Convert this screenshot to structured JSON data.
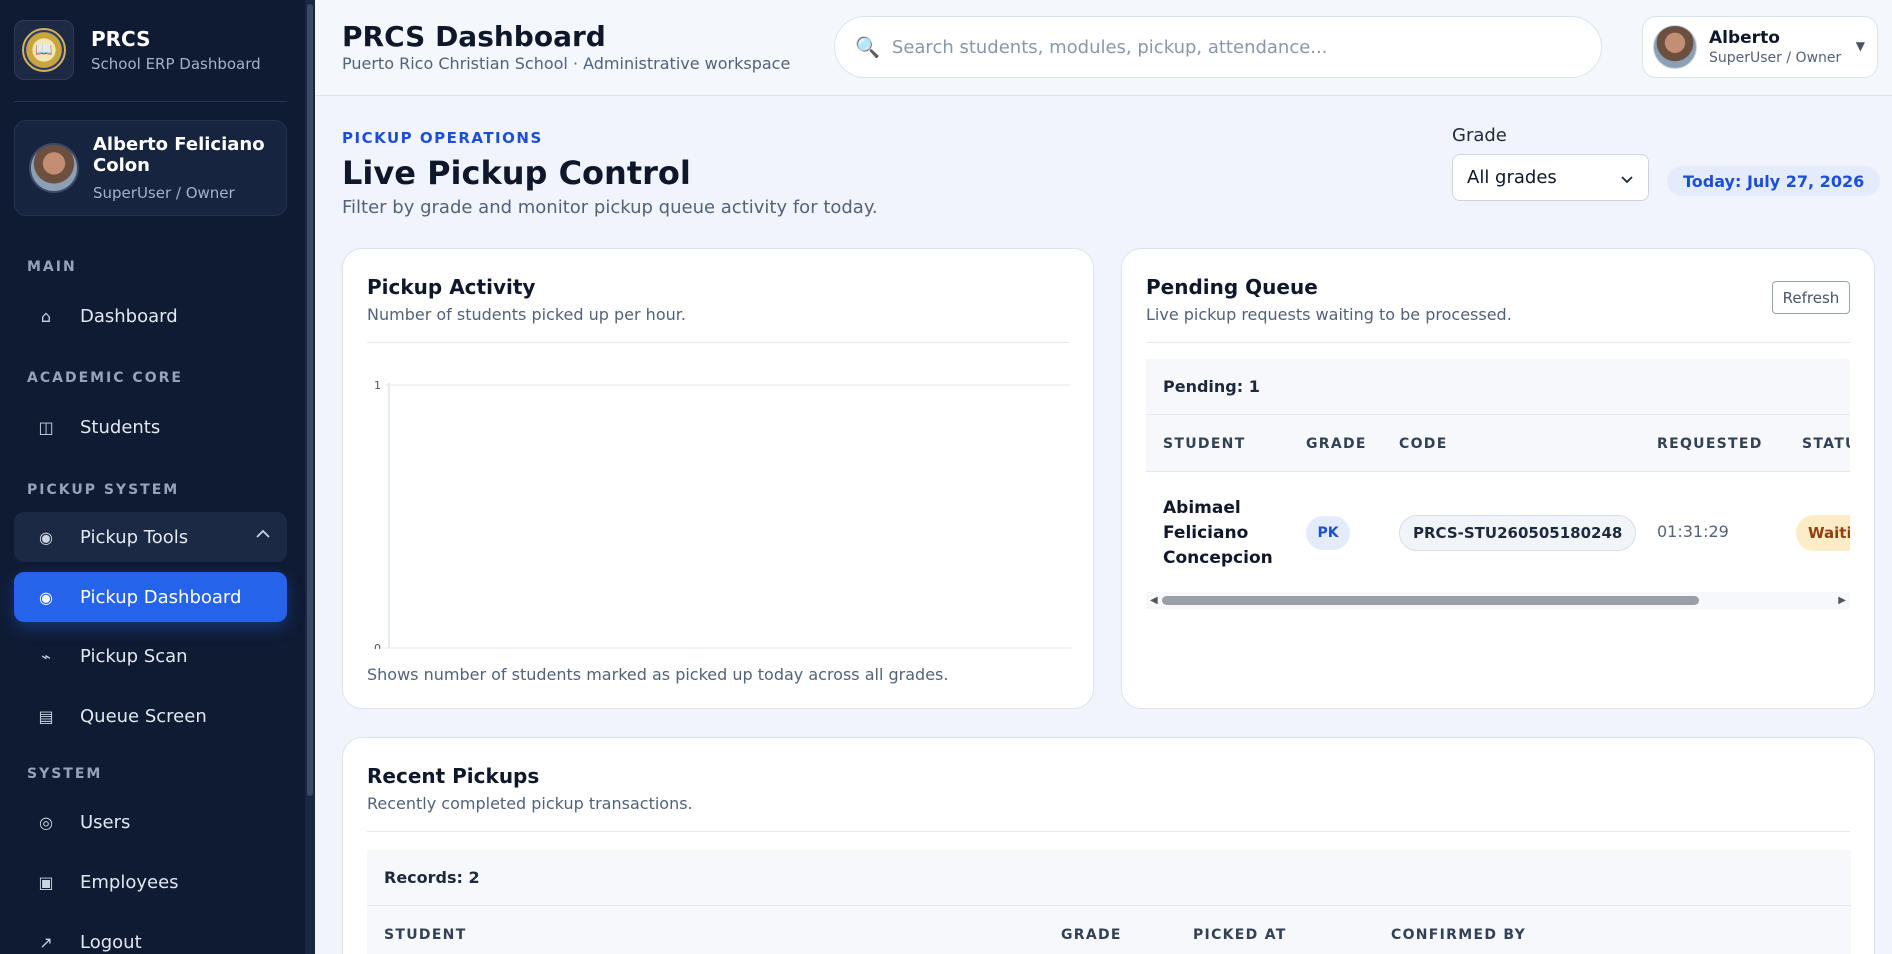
{
  "sidebar": {
    "brand_name": "PRCS",
    "brand_sub": "School ERP Dashboard",
    "user": {
      "name": "Alberto Feliciano Colon",
      "role": "SuperUser / Owner"
    },
    "sections": {
      "main": "MAIN",
      "academic": "ACADEMIC CORE",
      "pickup": "PICKUP SYSTEM",
      "system": "SYSTEM"
    },
    "items": {
      "dashboard": {
        "label": "Dashboard",
        "icon": "home-icon",
        "glyph": "⌂"
      },
      "students": {
        "label": "Students",
        "icon": "book-icon",
        "glyph": "◫"
      },
      "pickup_tools": {
        "label": "Pickup Tools",
        "icon": "target-icon",
        "glyph": "◉"
      },
      "pickup_dashboard": {
        "label": "Pickup Dashboard",
        "icon": "target-icon",
        "glyph": "◉"
      },
      "pickup_scan": {
        "label": "Pickup Scan",
        "icon": "scan-icon",
        "glyph": "⌁"
      },
      "queue_screen": {
        "label": "Queue Screen",
        "icon": "monitor-icon",
        "glyph": "▤"
      },
      "users": {
        "label": "Users",
        "icon": "user-circle-icon",
        "glyph": "◎"
      },
      "employees": {
        "label": "Employees",
        "icon": "id-card-icon",
        "glyph": "▣"
      },
      "logout": {
        "label": "Logout",
        "icon": "logout-icon",
        "glyph": "↗"
      }
    }
  },
  "header": {
    "title": "PRCS Dashboard",
    "subtitle": "Puerto Rico Christian School · Administrative workspace",
    "search_placeholder": "Search students, modules, pickup, attendance...",
    "profile_name": "Alberto",
    "profile_role": "SuperUser / Owner"
  },
  "page": {
    "kicker": "PICKUP OPERATIONS",
    "title": "Live Pickup Control",
    "lede": "Filter by grade and monitor pickup queue activity for today.",
    "grade_label": "Grade",
    "grade_value": "All grades",
    "today": "Today: July 27, 2026"
  },
  "activity": {
    "title": "Pickup Activity",
    "subtitle": "Number of students picked up per hour.",
    "note": "Shows number of students marked as picked up today across all grades."
  },
  "chart_data": {
    "type": "line",
    "x": [],
    "series": [],
    "ylim": [
      0,
      1
    ],
    "yticks": [
      "0",
      "1"
    ],
    "grid": false
  },
  "queue": {
    "title": "Pending Queue",
    "subtitle": "Live pickup requests waiting to be processed.",
    "refresh_label": "Refresh",
    "count_label": "Pending: 1",
    "columns": [
      "STUDENT",
      "GRADE",
      "CODE",
      "REQUESTED",
      "STATUS"
    ],
    "rows": [
      {
        "student": "Abimael Feliciano Concepcion",
        "grade": "PK",
        "code": "PRCS-STU260505180248",
        "requested": "01:31:29",
        "status": "Waiting"
      }
    ]
  },
  "recent": {
    "title": "Recent Pickups",
    "subtitle": "Recently completed pickup transactions.",
    "count_label": "Records: 2",
    "columns": [
      "STUDENT",
      "GRADE",
      "PICKED AT",
      "CONFIRMED BY"
    ]
  },
  "colors": {
    "sidebar_bg": "#0f1b33",
    "accent": "#2563eb",
    "status_waiting_bg": "#fdecc8",
    "status_waiting_text": "#92400e"
  }
}
